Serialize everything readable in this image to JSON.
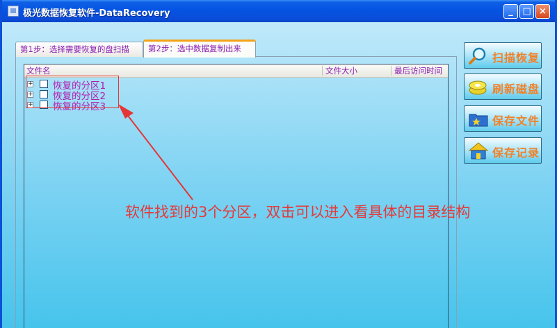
{
  "window": {
    "title": "极光数据恢复软件-DataRecovery"
  },
  "titlebar_buttons": {
    "minimize": "_",
    "maximize": "□",
    "close": "×"
  },
  "tabs": [
    {
      "label": "第1步：选择需要恢复的盘扫描"
    },
    {
      "label": "第2步：选中数据复制出来"
    }
  ],
  "file_list": {
    "columns": [
      "文件名",
      "文件大小",
      "最后访问时间"
    ],
    "rows": [
      {
        "expander": "+",
        "name": "恢复的分区1"
      },
      {
        "expander": "+",
        "name": "恢复的分区2"
      },
      {
        "expander": "+",
        "name": "恢复的分区3"
      }
    ]
  },
  "annotation": {
    "text": "软件找到的3个分区，双击可以进入看具体的目录结构",
    "color": "#e33a3a"
  },
  "side_buttons": [
    {
      "label": "扫描恢复",
      "icon": "magnifier-icon"
    },
    {
      "label": "刷新磁盘",
      "icon": "disk-stack-icon"
    },
    {
      "label": "保存文件",
      "icon": "folder-star-icon"
    },
    {
      "label": "保存记录",
      "icon": "house-icon"
    }
  ],
  "colors": {
    "title_bar": "#0554e2",
    "accent_label": "#f0822a",
    "tree_text": "#b01ab0"
  }
}
